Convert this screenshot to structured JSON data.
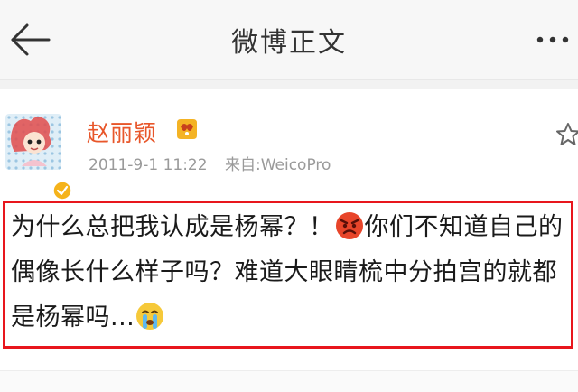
{
  "nav": {
    "title": "微博正文",
    "back_icon": "arrow-left-icon",
    "more_icon": "more-dots-icon"
  },
  "post": {
    "author_name": "赵丽颖",
    "timestamp": "2011-9-1 11:22",
    "source": "来自:WeicoPro",
    "icons": {
      "avatar": "avatar",
      "verified": "verified-badge-icon",
      "vip": "vip-badge-icon",
      "star": "star-icon"
    },
    "content": {
      "part1": "为什么总把我认成是杨幂？！",
      "emoji1": "angry-emoji-icon",
      "part2": "你们不知道自己的偶像长什么样子吗？难道大眼睛梳中分拍宫的就都是杨幂吗...",
      "emoji2": "crying-emoji-icon"
    },
    "highlight_color": "#e8161d",
    "name_color": "#e8562a"
  }
}
